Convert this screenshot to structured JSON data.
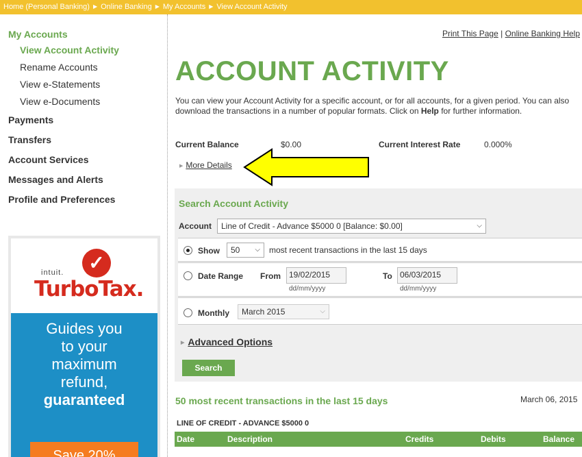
{
  "breadcrumb": [
    "Home (Personal Banking)",
    "Online Banking",
    "My Accounts",
    "View Account Activity"
  ],
  "sidebar": {
    "my_accounts": "My Accounts",
    "sub_items": [
      "View Account Activity",
      "Rename Accounts",
      "View e-Statements",
      "View e-Documents"
    ],
    "sections": [
      "Payments",
      "Transfers",
      "Account Services",
      "Messages and Alerts",
      "Profile and Preferences"
    ]
  },
  "ad": {
    "brand_small": "intuit.",
    "brand": "TurboTax.",
    "lines": [
      "Guides you",
      "to your",
      "maximum",
      "refund,"
    ],
    "bold_line": "guaranteed",
    "cta": "Save 20%"
  },
  "header": {
    "print_link": "Print This Page",
    "separator": "|",
    "help_link": "Online Banking Help",
    "title": "ACCOUNT ACTIVITY",
    "intro_1": "You can view your Account Activity for a specific account, or for all accounts, for a given period. You can also download the transactions in a number of popular formats. Click on ",
    "intro_help": "Help",
    "intro_2": " for further information."
  },
  "balance": {
    "current_balance_label": "Current Balance",
    "current_balance": "$0.00",
    "interest_rate_label": "Current Interest Rate",
    "interest_rate": "0.000%",
    "more_details": "More Details"
  },
  "search": {
    "title": "Search Account Activity",
    "account_label": "Account",
    "account_value": "Line of Credit - Advance $5000 0 [Balance: $0.00]",
    "show_label": "Show",
    "show_count": "50",
    "show_suffix": "most recent transactions in the last 15 days",
    "date_range_label": "Date Range",
    "from_label": "From",
    "from_value": "19/02/2015",
    "to_label": "To",
    "to_value": "06/03/2015",
    "date_format": "dd/mm/yyyy",
    "monthly_label": "Monthly",
    "month_value": "March 2015",
    "advanced_options": "Advanced Options",
    "search_button": "Search",
    "selected_option": "show"
  },
  "results": {
    "title": "50 most recent transactions in the last 15 days",
    "date": "March 06, 2015",
    "account_name": "LINE OF CREDIT - ADVANCE $5000 0",
    "columns": [
      "Date",
      "Description",
      "Credits",
      "Debits",
      "Balance"
    ]
  },
  "colors": {
    "breadcrumb_bg": "#f2c12e",
    "brand_green": "#6aa84f",
    "ad_blue": "#1d8fc6",
    "ad_orange": "#f57c20",
    "arrow_yellow": "#ffff00"
  }
}
